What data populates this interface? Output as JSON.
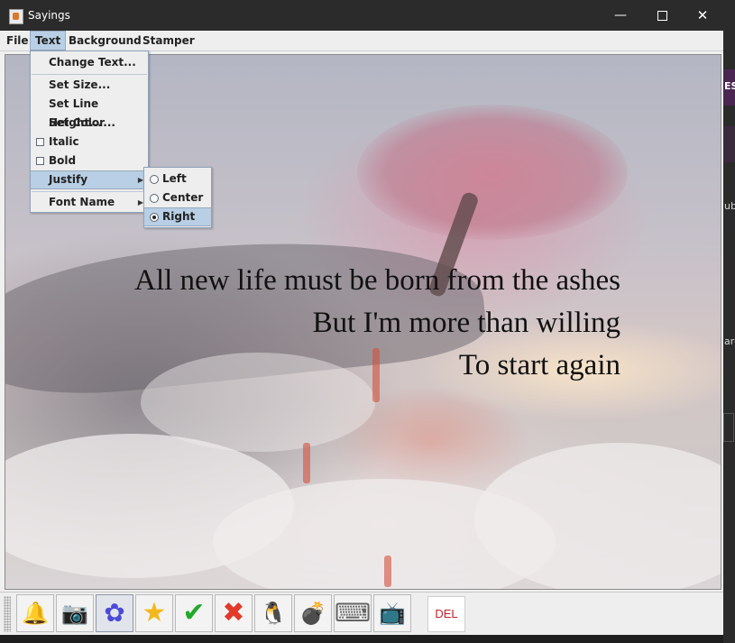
{
  "window": {
    "title": "Sayings",
    "minimize": "—",
    "close": "✕"
  },
  "menubar": [
    "File",
    "Text",
    "Background",
    "Stamper"
  ],
  "text_menu": {
    "items": [
      "Change Text...",
      "Set Size...",
      "Set Line Height...",
      "Set Color...",
      "Italic",
      "Bold",
      "Justify",
      "Font Name"
    ],
    "italic_checked": false,
    "bold_checked": false
  },
  "justify_menu": {
    "options": [
      "Left",
      "Center",
      "Right"
    ],
    "selected": "Right"
  },
  "saying": {
    "lines": [
      "All new life must be born from the ashes",
      "But I'm more than willing",
      "To start again"
    ],
    "justify": "right",
    "color": "#111111"
  },
  "toolbar": {
    "buttons": [
      {
        "name": "bell-icon",
        "glyph": "🔔"
      },
      {
        "name": "camera-icon",
        "glyph": "📷"
      },
      {
        "name": "flower-icon",
        "glyph": "✿"
      },
      {
        "name": "star-icon",
        "glyph": "★"
      },
      {
        "name": "checkmark-icon",
        "glyph": "✔"
      },
      {
        "name": "x-mark-icon",
        "glyph": "✖"
      },
      {
        "name": "penguin-icon",
        "glyph": "🐧"
      },
      {
        "name": "bomb-icon",
        "glyph": "💣"
      },
      {
        "name": "keyboard-icon",
        "glyph": "⌨"
      },
      {
        "name": "tv-icon",
        "glyph": "📺"
      }
    ],
    "delete_label": "DEL"
  },
  "colors": {
    "menu_highlight": "#b8cfe5",
    "titlebar": "#2b2b2b",
    "delete_text": "#c0242a"
  },
  "desktop_edge": {
    "text1": "ES",
    "text2": "ub",
    "text3": "ard"
  }
}
